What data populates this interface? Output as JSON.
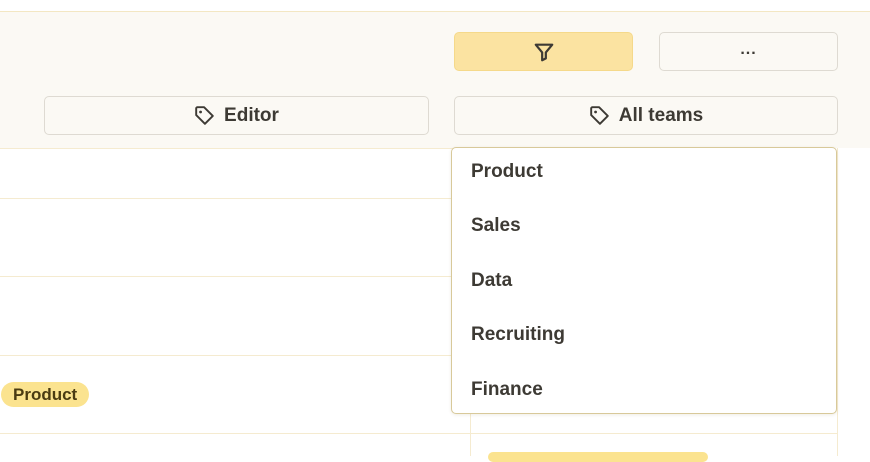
{
  "toolbar": {
    "filter_icon": "filter-icon",
    "more_label": "...",
    "editor_label": "Editor",
    "teams_label": "All teams",
    "tag_icon": "tag-icon"
  },
  "table": {
    "badge_label": "Product"
  },
  "team_dropdown": {
    "options": [
      "Product",
      "Sales",
      "Data",
      "Recruiting",
      "Finance"
    ]
  },
  "colors": {
    "accent": "#fbe3a1",
    "badge": "#fbe38f",
    "toolbar_bg": "#fbf9f4",
    "border": "#dedad2"
  }
}
